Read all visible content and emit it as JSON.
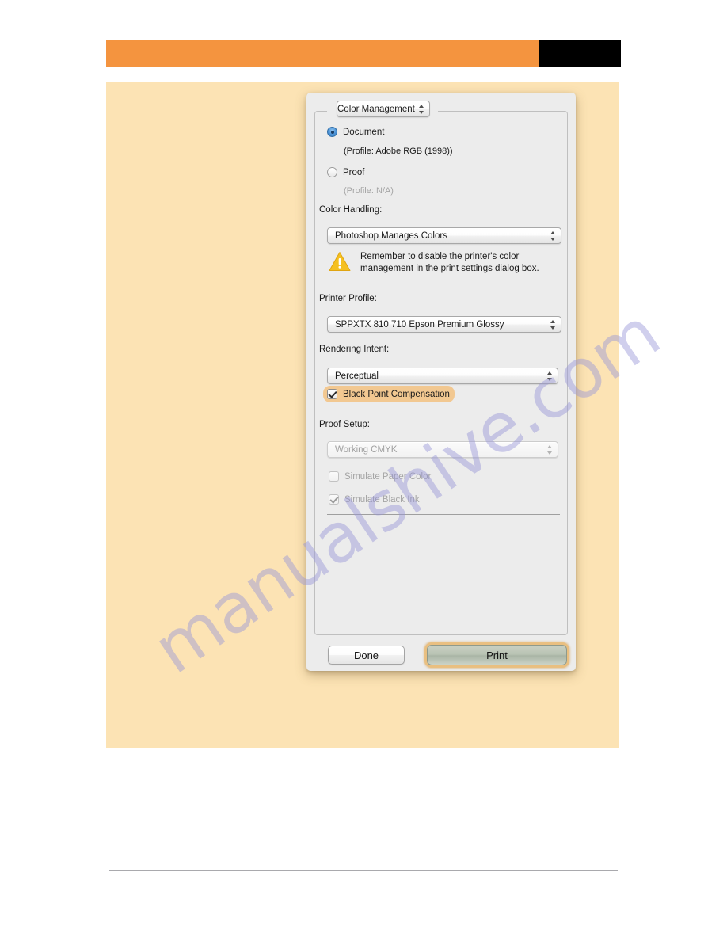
{
  "header": {
    "orange_color": "#f4943f",
    "black_color": "#000000"
  },
  "page": {
    "background_color": "#fce3b4"
  },
  "watermark": {
    "text": "manualshive.com",
    "color": "#9694d6"
  },
  "dialog": {
    "section_popup": {
      "selected": "Color Management",
      "options": [
        "Color Management"
      ]
    },
    "source_space": {
      "document": {
        "label": "Document",
        "selected": true,
        "profile_note": "(Profile: Adobe RGB (1998))"
      },
      "proof": {
        "label": "Proof",
        "selected": false,
        "profile_note": "(Profile: N/A)"
      }
    },
    "color_handling": {
      "label": "Color Handling:",
      "selected": "Photoshop Manages Colors",
      "options": [
        "Photoshop Manages Colors"
      ]
    },
    "warning": {
      "icon": "warning-triangle-icon",
      "text": "Remember to disable the printer's color management in the print settings dialog box.",
      "color": "#f2b91c"
    },
    "printer_profile": {
      "label": "Printer Profile:",
      "selected": "SPPXTX 810 710 Epson Premium Glossy",
      "options": [
        "SPPXTX 810 710 Epson Premium Glossy"
      ]
    },
    "rendering_intent": {
      "label": "Rendering Intent:",
      "selected": "Perceptual",
      "options": [
        "Perceptual"
      ]
    },
    "black_point_compensation": {
      "label": "Black Point Compensation",
      "checked": true,
      "highlight_color": "#f4ba6e"
    },
    "proof_setup": {
      "label": "Proof Setup:",
      "selected": "Working CMYK",
      "options": [
        "Working CMYK"
      ],
      "disabled": true
    },
    "simulate_paper_color": {
      "label": "Simulate Paper Color",
      "checked": false,
      "disabled": true
    },
    "simulate_black_ink": {
      "label": "Simulate Black Ink",
      "checked": true,
      "disabled": true
    },
    "buttons": {
      "done": "Done",
      "print": "Print"
    }
  }
}
